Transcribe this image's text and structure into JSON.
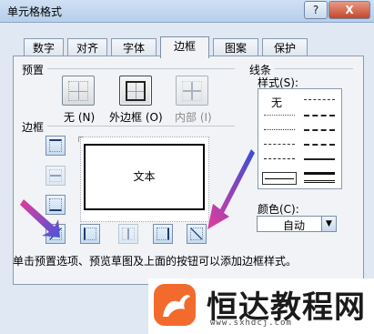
{
  "window": {
    "title": "单元格格式",
    "help": "?",
    "close": "X"
  },
  "tabs": [
    "数字",
    "对齐",
    "字体",
    "边框",
    "图案",
    "保护"
  ],
  "active_tab": "边框",
  "presets": {
    "label": "预置",
    "items": [
      {
        "label": "无 (N)",
        "state": "enabled"
      },
      {
        "label": "外边框 (O)",
        "state": "selected"
      },
      {
        "label": "内部 (I)",
        "state": "disabled"
      }
    ]
  },
  "border": {
    "label": "边框",
    "preview_text": "文本"
  },
  "line": {
    "label": "线条",
    "style_label": "样式(S):",
    "none_label": "无",
    "color_label": "颜色(C):",
    "color_value": "自动"
  },
  "note": "单击预置选项、预览草图及上面的按钮可以添加边框样式。",
  "watermark": {
    "name": "恒达教程网",
    "url": "www.sxhdcj.com"
  },
  "colors": {
    "accent_arrow": "#4a55d8",
    "arrow_tip": "#e23c9a",
    "logo": "#f26a2c"
  }
}
